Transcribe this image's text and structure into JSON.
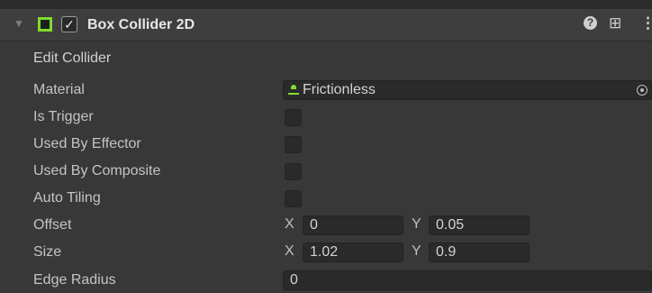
{
  "component": {
    "title": "Box Collider 2D",
    "enabled": true,
    "icons": {
      "fold": "triangle-down-icon",
      "component": "box-collider-2d-icon",
      "enable": "checkmark-icon",
      "help": "help-icon",
      "presets": "presets-icon",
      "menu": "kebab-menu-icon"
    },
    "accent_color": "#7fdc2c"
  },
  "edit_collider": {
    "label": "Edit Collider"
  },
  "fields": {
    "material": {
      "label": "Material",
      "value": "Frictionless"
    },
    "is_trigger": {
      "label": "Is Trigger",
      "checked": false
    },
    "used_by_effector": {
      "label": "Used By Effector",
      "checked": false
    },
    "used_by_composite": {
      "label": "Used By Composite",
      "checked": false
    },
    "auto_tiling": {
      "label": "Auto Tiling",
      "checked": false
    },
    "offset": {
      "label": "Offset",
      "x_label": "X",
      "x": "0",
      "y_label": "Y",
      "y": "0.05"
    },
    "size": {
      "label": "Size",
      "x_label": "X",
      "x": "1.02",
      "y_label": "Y",
      "y": "0.9"
    },
    "edge_radius": {
      "label": "Edge Radius",
      "value": "0"
    }
  }
}
